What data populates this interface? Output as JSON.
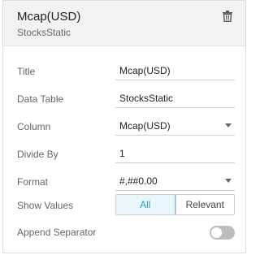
{
  "header": {
    "title": "Mcap(USD)",
    "subtitle": "StocksStatic",
    "delete_icon": "trash-icon"
  },
  "form": {
    "title": {
      "label": "Title",
      "value": "Mcap(USD)"
    },
    "data_table": {
      "label": "Data Table",
      "value": "StocksStatic"
    },
    "column": {
      "label": "Column",
      "value": "Mcap(USD)"
    },
    "divide_by": {
      "label": "Divide By",
      "value": "1"
    },
    "format": {
      "label": "Format",
      "value": "#,##0.00"
    },
    "show_values": {
      "label": "Show Values",
      "options": [
        "All",
        "Relevant"
      ],
      "selected": "All"
    },
    "append_separator": {
      "label": "Append Separator",
      "enabled": false
    }
  },
  "colors": {
    "accent": "#2a9cc4",
    "active_bg": "#e9f7fb",
    "switch_off": "#bdbdbd"
  }
}
